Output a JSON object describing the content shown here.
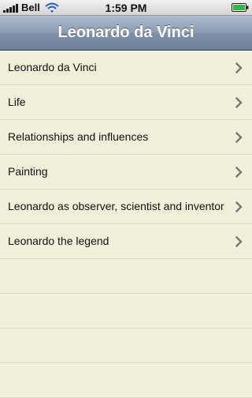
{
  "status_bar": {
    "carrier": "Bell",
    "time": "1:59 PM",
    "icons": [
      "signal-bars-icon",
      "wifi-icon",
      "battery-icon"
    ]
  },
  "nav_bar": {
    "title": "Leonardo da Vinci"
  },
  "list": {
    "items": [
      {
        "label": "Leonardo da Vinci",
        "icon": "chevron-right-icon"
      },
      {
        "label": "Life",
        "icon": "chevron-right-icon"
      },
      {
        "label": "Relationships and influences",
        "icon": "chevron-right-icon"
      },
      {
        "label": "Painting",
        "icon": "chevron-right-icon"
      },
      {
        "label": "Leonardo as observer, scientist and inventor",
        "icon": "chevron-right-icon"
      },
      {
        "label": "Leonardo the legend",
        "icon": "chevron-right-icon"
      }
    ]
  },
  "colors": {
    "background": "#f0f0da",
    "nav_bar": "#8b9cb5",
    "row_separator": "#d9d9c6",
    "chevron": "#7a7a7a"
  }
}
